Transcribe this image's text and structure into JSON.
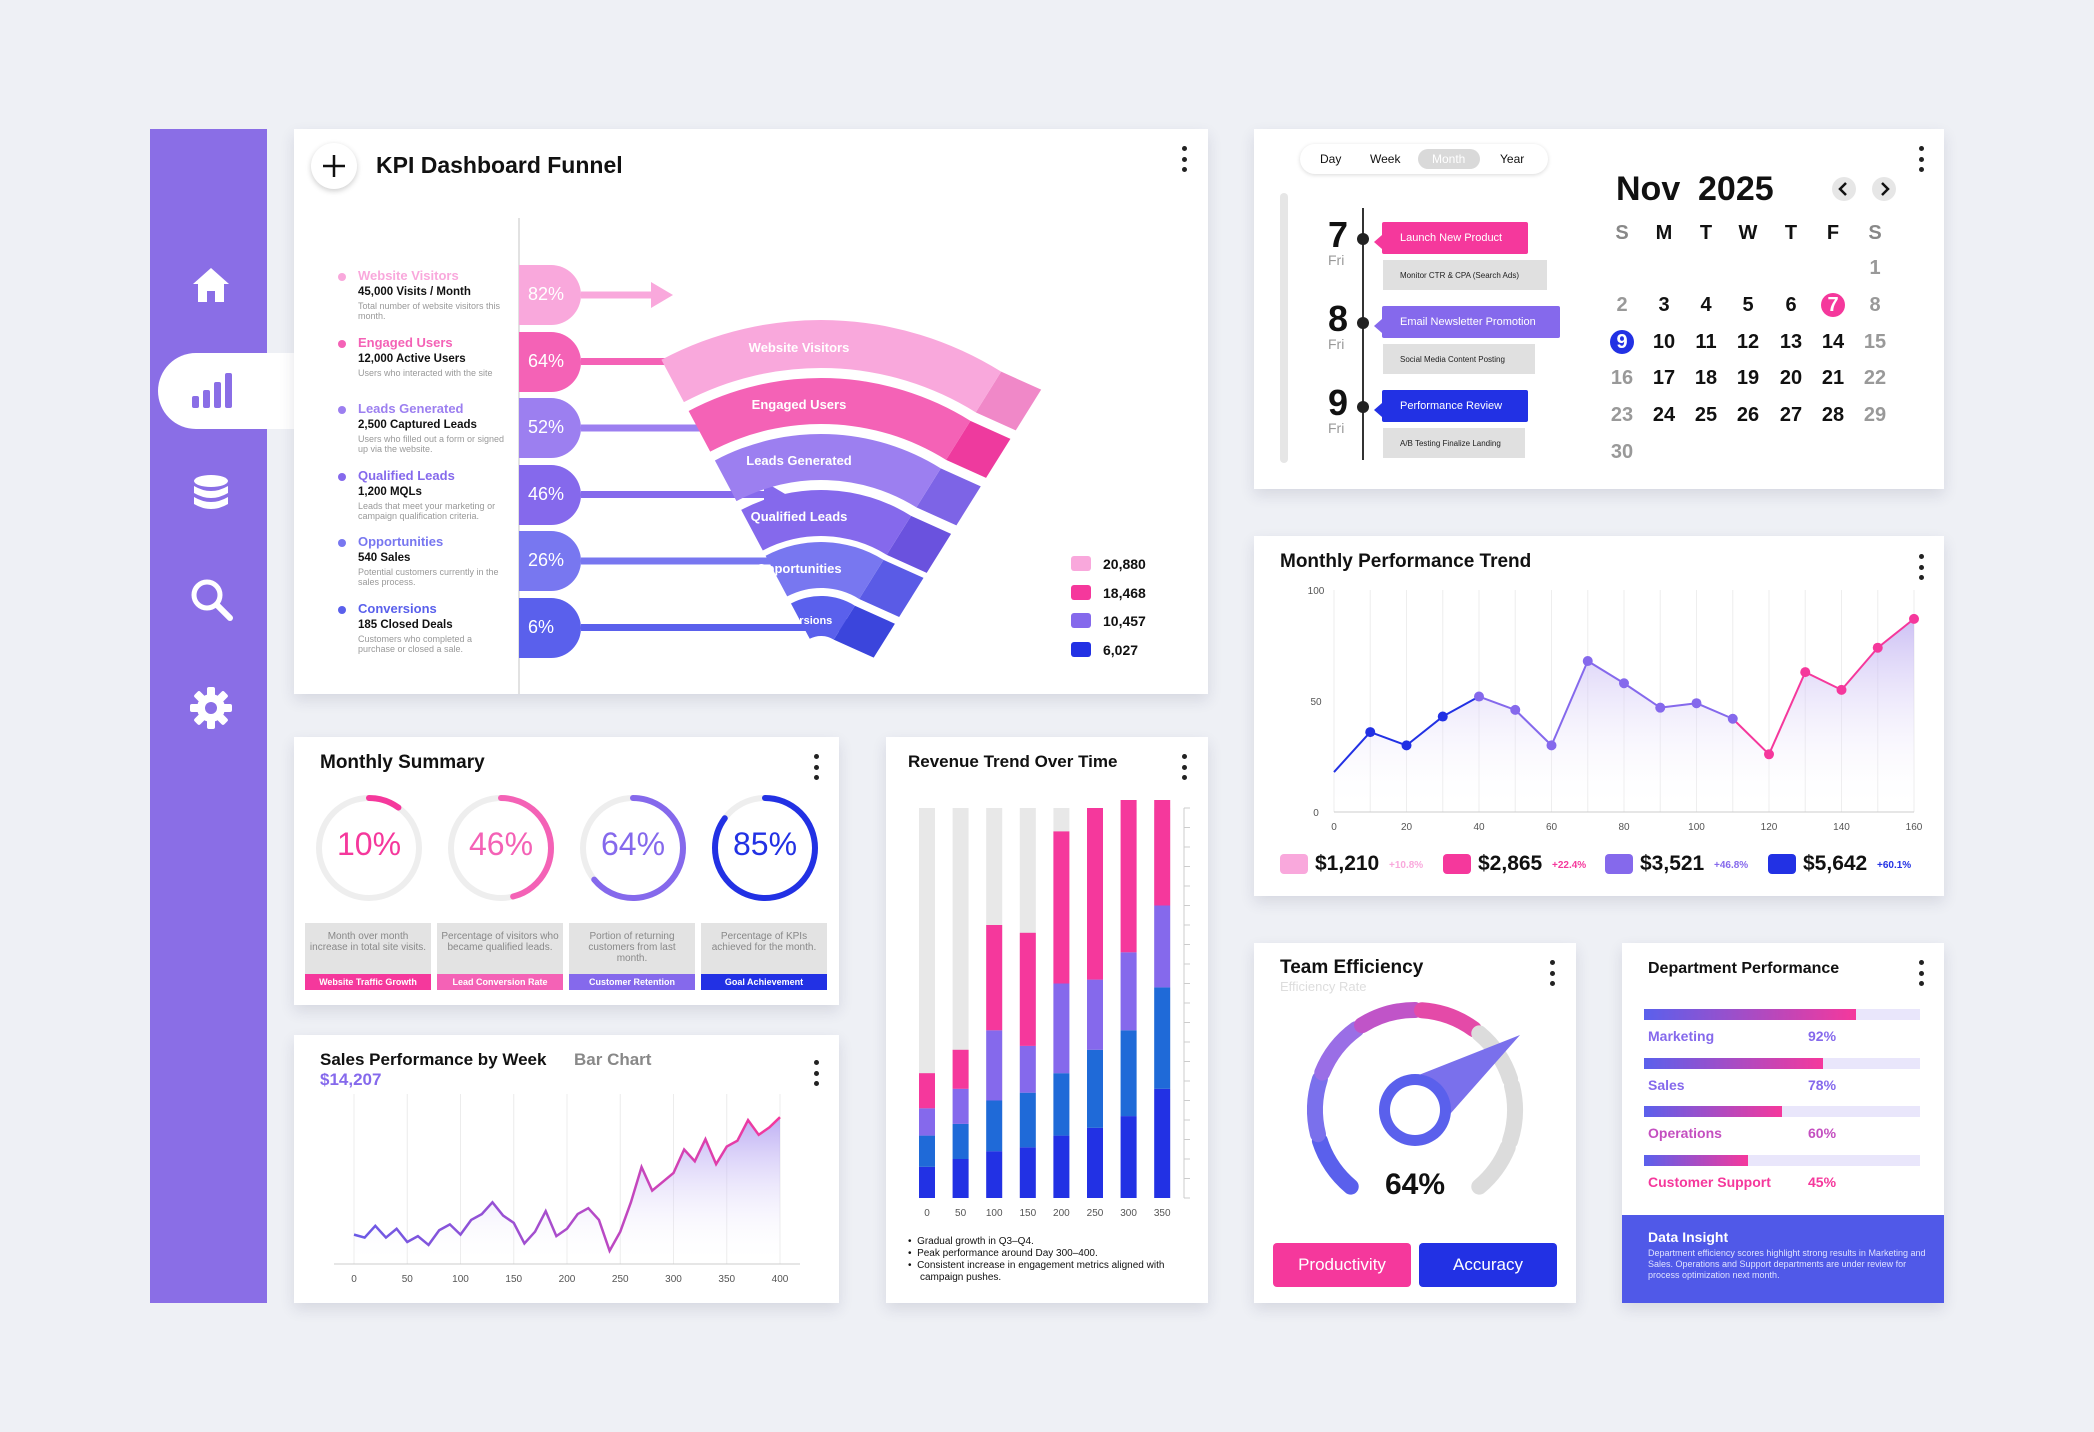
{
  "colors": {
    "sidebar": "#8a6ee6",
    "pink": "#f5389c",
    "lightpink": "#f9a8dc",
    "purple": "#8569ec",
    "blue": "#2231e4"
  },
  "sidebar": {
    "items": [
      {
        "icon": "home-icon"
      },
      {
        "icon": "bar-chart-icon",
        "active": true
      },
      {
        "icon": "database-icon"
      },
      {
        "icon": "search-icon"
      },
      {
        "icon": "gear-icon"
      }
    ]
  },
  "funnel": {
    "title": "KPI Dashboard Funnel",
    "stages": [
      {
        "name": "Website Visitors",
        "value": "45,000 Visits / Month",
        "desc": "Total number of website visitors this month.",
        "pct": "82%",
        "color": "#f9a8dc"
      },
      {
        "name": "Engaged Users",
        "value": "12,000 Active Users",
        "desc": "Users who interacted with the site",
        "pct": "64%",
        "color": "#f462b6"
      },
      {
        "name": "Leads Generated",
        "value": "2,500 Captured Leads",
        "desc": "Users who filled out a form or signed up via the website.",
        "pct": "52%",
        "color": "#9c7ff0"
      },
      {
        "name": "Qualified Leads",
        "value": "1,200 MQLs",
        "desc": "Leads that meet your marketing or campaign qualification criteria.",
        "pct": "46%",
        "color": "#8569ec"
      },
      {
        "name": "Opportunities",
        "value": "540 Sales",
        "desc": "Potential customers currently in the sales process.",
        "pct": "26%",
        "color": "#7877f0"
      },
      {
        "name": "Conversions",
        "value": "185 Closed Deals",
        "desc": "Customers who completed a purchase or closed a sale.",
        "pct": "6%",
        "color": "#5a60ec"
      }
    ],
    "legend": [
      {
        "value": "20,880",
        "color": "#f9a8dc"
      },
      {
        "value": "18,468",
        "color": "#f5389c"
      },
      {
        "value": "10,457",
        "color": "#8569ec"
      },
      {
        "value": "6,027",
        "color": "#2231e4"
      }
    ]
  },
  "calendar": {
    "views": [
      "Day",
      "Week",
      "Month",
      "Year"
    ],
    "active_view": "Month",
    "month": "Nov",
    "year": "2025",
    "weekdays": [
      "S",
      "M",
      "T",
      "W",
      "T",
      "F",
      "S"
    ],
    "days": [
      [
        null,
        null,
        null,
        null,
        null,
        null,
        1
      ],
      [
        2,
        3,
        4,
        5,
        6,
        7,
        8
      ],
      [
        9,
        10,
        11,
        12,
        13,
        14,
        15
      ],
      [
        16,
        17,
        18,
        19,
        20,
        21,
        22
      ],
      [
        23,
        24,
        25,
        26,
        27,
        28,
        29
      ],
      [
        30,
        null,
        null,
        null,
        null,
        null,
        null
      ]
    ],
    "today": 7,
    "selected": 9,
    "schedule": [
      {
        "day": "7",
        "dow": "Fri",
        "event": "Launch New Product",
        "sub": "Monitor CTR & CPA (Search Ads)",
        "color": "#f5389c"
      },
      {
        "day": "8",
        "dow": "Fri",
        "event": "Email Newsletter Promotion",
        "sub": "Social Media Content Posting",
        "color": "#8569ec"
      },
      {
        "day": "9",
        "dow": "Fri",
        "event": "Performance Review",
        "sub": "A/B Testing Finalize Landing",
        "color": "#2231e4"
      }
    ]
  },
  "trend": {
    "title": "Monthly Performance Trend",
    "stats": [
      {
        "value": "$1,210",
        "change": "+10.8%",
        "color": "#f9a8dc"
      },
      {
        "value": "$2,865",
        "change": "+22.4%",
        "color": "#f5389c"
      },
      {
        "value": "$3,521",
        "change": "+46.8%",
        "color": "#8569ec"
      },
      {
        "value": "$5,642",
        "change": "+60.1%",
        "color": "#2231e4"
      }
    ]
  },
  "summary": {
    "title": "Monthly Summary",
    "items": [
      {
        "pct": "10%",
        "value": 10,
        "desc": "Month over month increase in total site visits.",
        "tag": "Website Traffic Growth",
        "color": "#f5389c"
      },
      {
        "pct": "46%",
        "value": 46,
        "desc": "Percentage of visitors who became qualified leads.",
        "tag": "Lead Conversion Rate",
        "color": "#f462b6"
      },
      {
        "pct": "64%",
        "value": 64,
        "desc": "Portion of returning customers from last month.",
        "tag": "Customer Retention",
        "color": "#8569ec"
      },
      {
        "pct": "85%",
        "value": 85,
        "desc": "Percentage of KPIs achieved for the month.",
        "tag": "Goal Achievement",
        "color": "#2231e4"
      }
    ]
  },
  "revenue": {
    "title": "Revenue Trend Over Time",
    "notes": [
      "Gradual growth in Q3–Q4.",
      "Peak performance around Day 300–400.",
      "Consistent increase in engagement metrics aligned with campaign pushes."
    ]
  },
  "sales": {
    "title": "Sales Performance by Week",
    "subtitle": "Bar Chart",
    "value": "$14,207"
  },
  "team": {
    "title": "Team Efficiency",
    "subtitle": "Efficiency Rate",
    "value": "64%",
    "buttons": [
      "Productivity",
      "Accuracy"
    ]
  },
  "dept": {
    "title": "Department Performance",
    "items": [
      {
        "name": "Marketing",
        "pct": "92%",
        "value": 92,
        "color": "#8569ec"
      },
      {
        "name": "Sales",
        "pct": "78%",
        "value": 78,
        "color": "#8569ec"
      },
      {
        "name": "Operations",
        "pct": "60%",
        "value": 60,
        "color": "#c44fc0"
      },
      {
        "name": "Customer Support",
        "pct": "45%",
        "value": 45,
        "color": "#f5389c"
      }
    ],
    "insight_title": "Data Insight",
    "insight_text": "Department efficiency scores highlight strong results in Marketing and Sales. Operations and Support departments are under review for process optimization next month."
  },
  "chart_data": [
    {
      "type": "line",
      "title": "Monthly Performance Trend",
      "xlim": [
        0,
        160
      ],
      "ylim": [
        0,
        100
      ],
      "x": [
        0,
        10,
        20,
        30,
        40,
        50,
        60,
        70,
        80,
        90,
        100,
        110,
        120,
        130,
        140,
        150,
        160
      ],
      "values": [
        18,
        36,
        30,
        43,
        52,
        46,
        30,
        68,
        58,
        47,
        49,
        42,
        26,
        63,
        55,
        74,
        87
      ]
    },
    {
      "type": "bar",
      "title": "Revenue Trend Over Time",
      "stacked": true,
      "categories": [
        "0",
        "50",
        "100",
        "150",
        "200",
        "250",
        "300",
        "350"
      ],
      "series": [
        {
          "name": "",
          "values": [
            8,
            10,
            12,
            13,
            16,
            18,
            21,
            28
          ]
        },
        {
          "name": "",
          "values": [
            8,
            9,
            13,
            14,
            16,
            20,
            22,
            26
          ]
        },
        {
          "name": "",
          "values": [
            7,
            9,
            18,
            12,
            23,
            18,
            20,
            21
          ]
        },
        {
          "name": "",
          "values": [
            9,
            10,
            27,
            29,
            39,
            44,
            44,
            40
          ]
        }
      ],
      "ylim": [
        0,
        100
      ]
    },
    {
      "type": "area",
      "title": "Sales Performance by Week",
      "xlim": [
        0,
        400
      ],
      "x": [
        0,
        10,
        20,
        30,
        40,
        50,
        60,
        70,
        80,
        90,
        100,
        110,
        120,
        130,
        140,
        150,
        160,
        170,
        180,
        190,
        200,
        210,
        220,
        230,
        240,
        250,
        260,
        270,
        280,
        290,
        300,
        310,
        320,
        330,
        340,
        350,
        360,
        370,
        380,
        390,
        400
      ],
      "values": [
        20,
        18,
        26,
        18,
        24,
        15,
        19,
        13,
        23,
        27,
        20,
        30,
        34,
        42,
        33,
        28,
        14,
        22,
        36,
        19,
        24,
        34,
        38,
        30,
        9,
        22,
        42,
        66,
        50,
        56,
        62,
        78,
        70,
        85,
        68,
        80,
        84,
        98,
        88,
        93,
        100
      ],
      "ylim": [
        0,
        110
      ]
    }
  ]
}
